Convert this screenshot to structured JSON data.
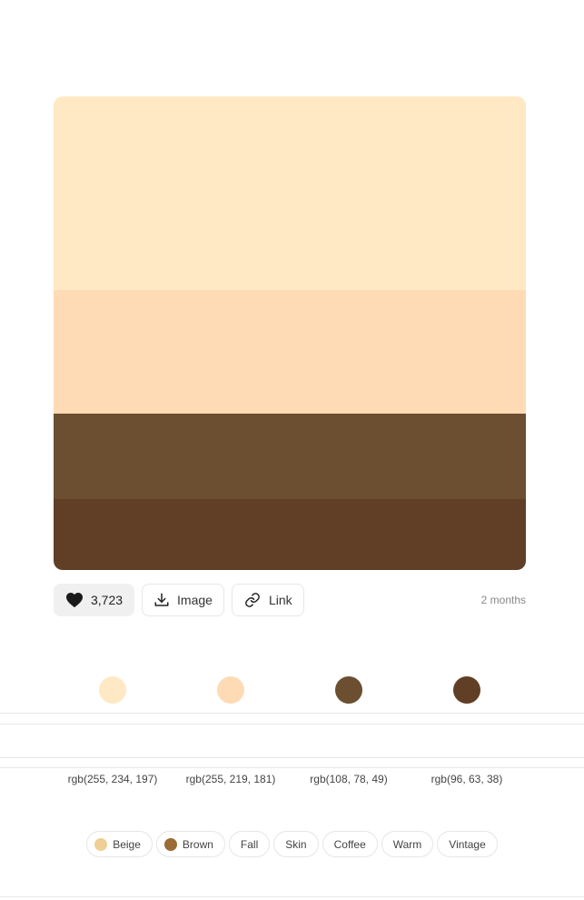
{
  "palette": {
    "colors": [
      {
        "hex": "#FFE9C5",
        "rgb": "rgb(255, 234, 197)"
      },
      {
        "hex": "#FFDBB5",
        "rgb": "rgb(255, 219, 181)"
      },
      {
        "hex": "#6C4E31",
        "rgb": "rgb(108, 78, 49)"
      },
      {
        "hex": "#603F26",
        "rgb": "rgb(96, 63, 38)"
      }
    ]
  },
  "actions": {
    "likes": "3,723",
    "image_label": "Image",
    "link_label": "Link",
    "time_ago": "2 months"
  },
  "tags": [
    {
      "label": "Beige",
      "dot_color": "#EFCF94"
    },
    {
      "label": "Brown",
      "dot_color": "#9A6B35"
    },
    {
      "label": "Fall"
    },
    {
      "label": "Skin"
    },
    {
      "label": "Coffee"
    },
    {
      "label": "Warm"
    },
    {
      "label": "Vintage"
    }
  ],
  "icons": {
    "like": "heart-icon",
    "image": "download-icon",
    "link": "link-icon"
  }
}
